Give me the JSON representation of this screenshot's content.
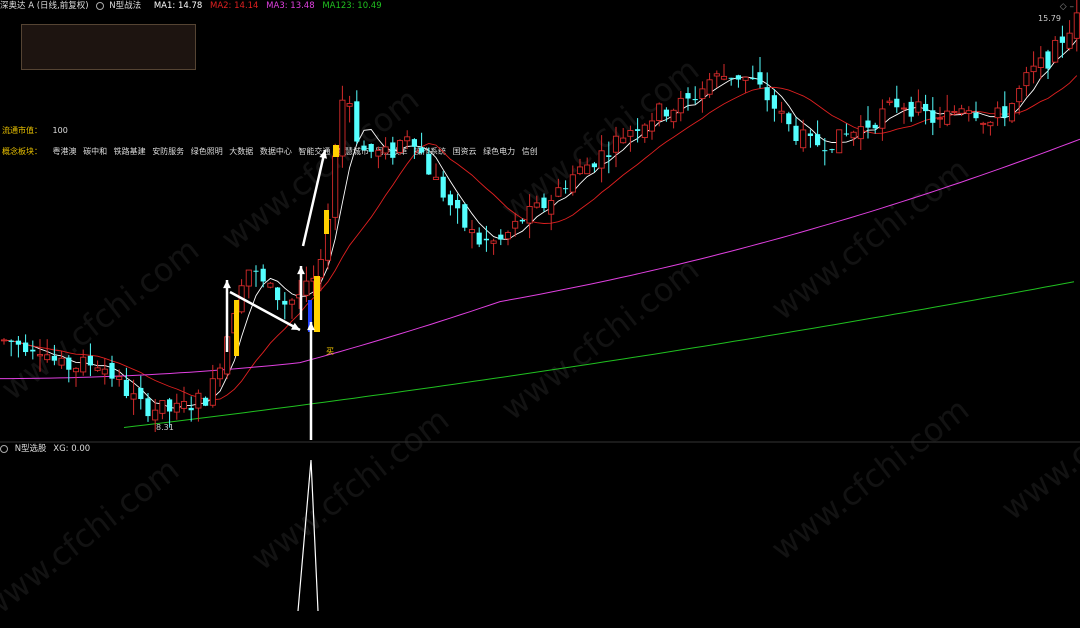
{
  "header": {
    "stock": "深奥达 A (日线,前复权)",
    "indicator": "N型战法",
    "ma1_label": "MA1: 14.78",
    "ma2_label": "MA2: 14.14",
    "ma3_label": "MA3: 13.48",
    "ma123_label": "MA123: 10.49"
  },
  "sub_header": {
    "indicator": "N型选股",
    "xg_label": "XG: 0.00"
  },
  "info": {
    "float_label": "流通市值：",
    "float_value": "100",
    "concept_label": "概念板块：",
    "concepts": [
      "粤港澳",
      "碳中和",
      "铁路基建",
      "安防服务",
      "绿色照明",
      "大数据",
      "数据中心",
      "智能交通",
      "智慧城市",
      "国企改革",
      "操作系统",
      "国资云",
      "绿色电力",
      "信创"
    ]
  },
  "labels": {
    "high_price": "15.79",
    "low_price": "8.31",
    "buy_signal": "买"
  },
  "colors": {
    "up": "#d42b2b",
    "down": "#54ffff",
    "ma1": "#ffffff",
    "ma2": "#e02020",
    "ma3": "#e040e0",
    "ma123": "#20c020",
    "signal_bar": "#ffd000",
    "label_yellow": "#e8c000"
  },
  "watermark": "www.cfchi.com",
  "chart_data": {
    "type": "candlestick",
    "price_range": [
      8.31,
      15.79
    ],
    "high": 15.79,
    "low": 8.31
  }
}
